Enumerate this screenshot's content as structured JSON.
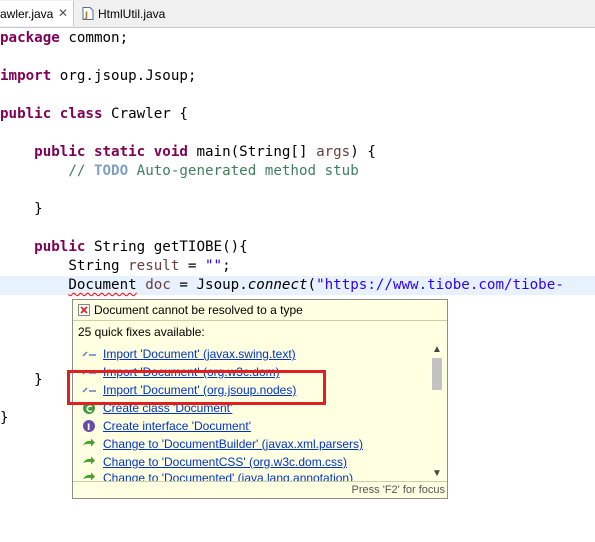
{
  "tabs": [
    {
      "label": "rawler.java",
      "close": "✕"
    },
    {
      "label": "HtmlUtil.java"
    }
  ],
  "code": {
    "l1": {
      "kw": "package",
      "rest": " common;"
    },
    "l2": {
      "kw": "import",
      "rest": " org.jsoup.Jsoup;"
    },
    "l3": {
      "kw1": "public",
      "kw2": "class",
      "rest": " Crawler {"
    },
    "l4": {
      "kw1": "public",
      "kw2": "static",
      "kw3": "void",
      "mid": " main(String[] ",
      "var": "args",
      "end": ") {"
    },
    "l5": {
      "cmt1": "// ",
      "todo": "TODO",
      "cmt2": " Auto-generated method stub"
    },
    "l6": {
      "text": "}"
    },
    "l7": {
      "kw": "public",
      "rest": " String getTIOBE(){"
    },
    "l8": {
      "a": "String ",
      "var": "result",
      "b": " = ",
      "str": "\"\"",
      "c": ";"
    },
    "l9": {
      "err": "Document",
      "a": " ",
      "var": "doc",
      "b": " = Jsoup.",
      "method": "connect",
      "c": "(",
      "str": "\"https://www.tiobe.com/tiobe-"
    },
    "l10": {
      "text": "}"
    },
    "l11": {
      "text": "}"
    }
  },
  "popup": {
    "title": "Document cannot be resolved to a type",
    "count": "25 quick fixes available:",
    "fixes": [
      {
        "label": "Import 'Document' (javax.swing.text)",
        "icon": "import-icon"
      },
      {
        "label": "Import 'Document' (org.w3c.dom)",
        "icon": "import-icon"
      },
      {
        "label": "Import 'Document' (org.jsoup.nodes)",
        "icon": "import-icon"
      },
      {
        "label": "Create class 'Document'",
        "icon": "class-icon"
      },
      {
        "label": "Create interface 'Document'",
        "icon": "interface-icon"
      },
      {
        "label": "Change to 'DocumentBuilder' (javax.xml.parsers)",
        "icon": "change-icon"
      },
      {
        "label": "Change to 'DocumentCSS' (org.w3c.dom.css)",
        "icon": "change-icon"
      },
      {
        "label": "Change to 'Documented' (java.lang.annotation)",
        "icon": "change-icon"
      }
    ],
    "footer": "Press 'F2' for focus",
    "colors": {
      "background": "#ffffe1",
      "link": "#0033cc",
      "highlight_box": "#e02020"
    }
  }
}
